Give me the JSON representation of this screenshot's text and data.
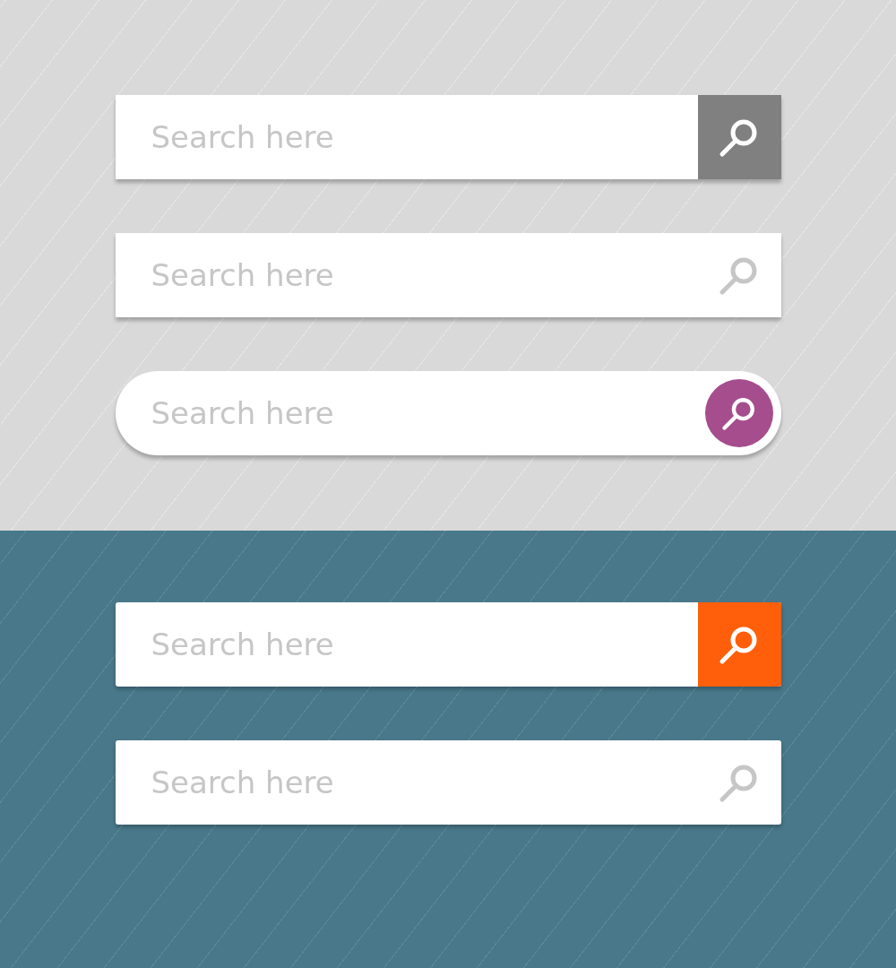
{
  "sections": [
    {
      "color": "#d9d9d9",
      "search_bars": [
        {
          "kind": "square-button",
          "placeholder": "Search here",
          "color": "#808080",
          "rounded": false
        },
        {
          "kind": "icon-only",
          "placeholder": "Search here",
          "rounded": false
        },
        {
          "kind": "pill",
          "placeholder": "Search here",
          "color": "#a64d8e"
        }
      ]
    },
    {
      "color": "#48788a",
      "search_bars": [
        {
          "kind": "square-button",
          "placeholder": "Search here",
          "color": "#ff5f0a",
          "rounded": true
        },
        {
          "kind": "icon-only",
          "placeholder": "Search here",
          "rounded": true
        }
      ]
    }
  ]
}
